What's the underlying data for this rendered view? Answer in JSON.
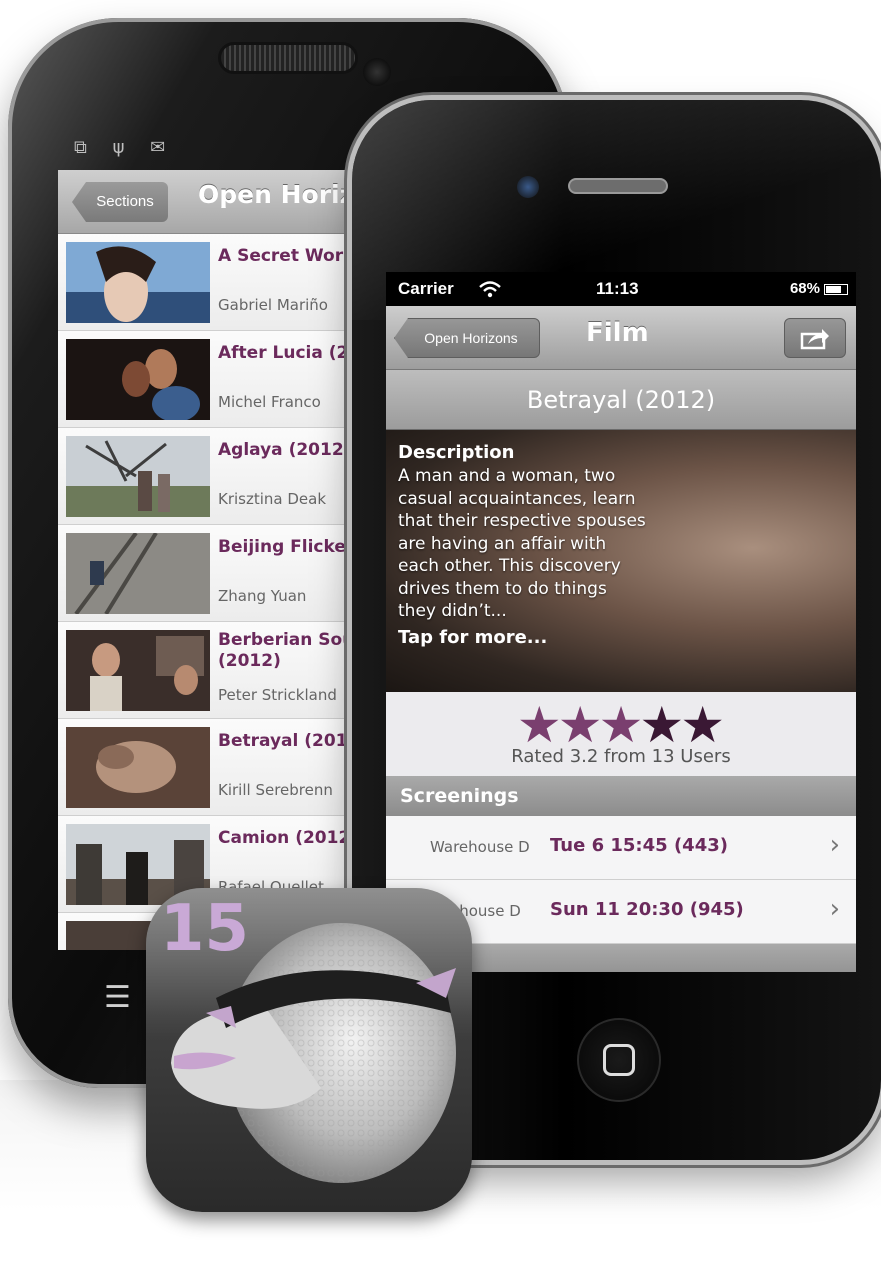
{
  "android": {
    "status_icons": "⧉ ψ ✉",
    "nav": {
      "back_label": "Sections",
      "title": "Open Horizo"
    },
    "films": [
      {
        "title": "A Secret World",
        "director": "Gabriel Mariño"
      },
      {
        "title": "After Lucia (2012)",
        "director": "Michel Franco"
      },
      {
        "title": "Aglaya (2012)",
        "director": "Krisztina Deak"
      },
      {
        "title": "Beijing Flicker",
        "director": "Zhang Yuan"
      },
      {
        "title": "Berberian Sou (2012)",
        "director": "Peter Strickland"
      },
      {
        "title": "Betrayal (2012)",
        "director": "Kirill Serebrenn"
      },
      {
        "title": "Camion (2012)",
        "director": "Rafael Ouellet"
      }
    ]
  },
  "iphone": {
    "status": {
      "carrier": "Carrier",
      "time": "11:13",
      "battery": "68%"
    },
    "nav": {
      "back_label": "Open Horizons",
      "title": "Film"
    },
    "film_title": "Betrayal (2012)",
    "description": {
      "heading": "Description",
      "body": "A man and a woman, two casual acquaintances, learn that their respective spouses are having an affair with each other. This discovery drives them to do things they didn’t...",
      "more": "Tap for more..."
    },
    "rating": {
      "value": 3.2,
      "max": 5,
      "text": "Rated 3.2 from 13 Users"
    },
    "screenings_header": "Screenings",
    "screenings": [
      {
        "venue": "Warehouse D",
        "when": "Tue 6  15:45  (443)"
      },
      {
        "venue": "ehouse D",
        "when": "Sun 11  20:30  (945)"
      }
    ],
    "colors": {
      "accent": "#6b2a5c",
      "star_on": "#7a3f6f",
      "star_off": "#3a1834"
    }
  },
  "app_icon": {
    "badge_number": "15"
  }
}
